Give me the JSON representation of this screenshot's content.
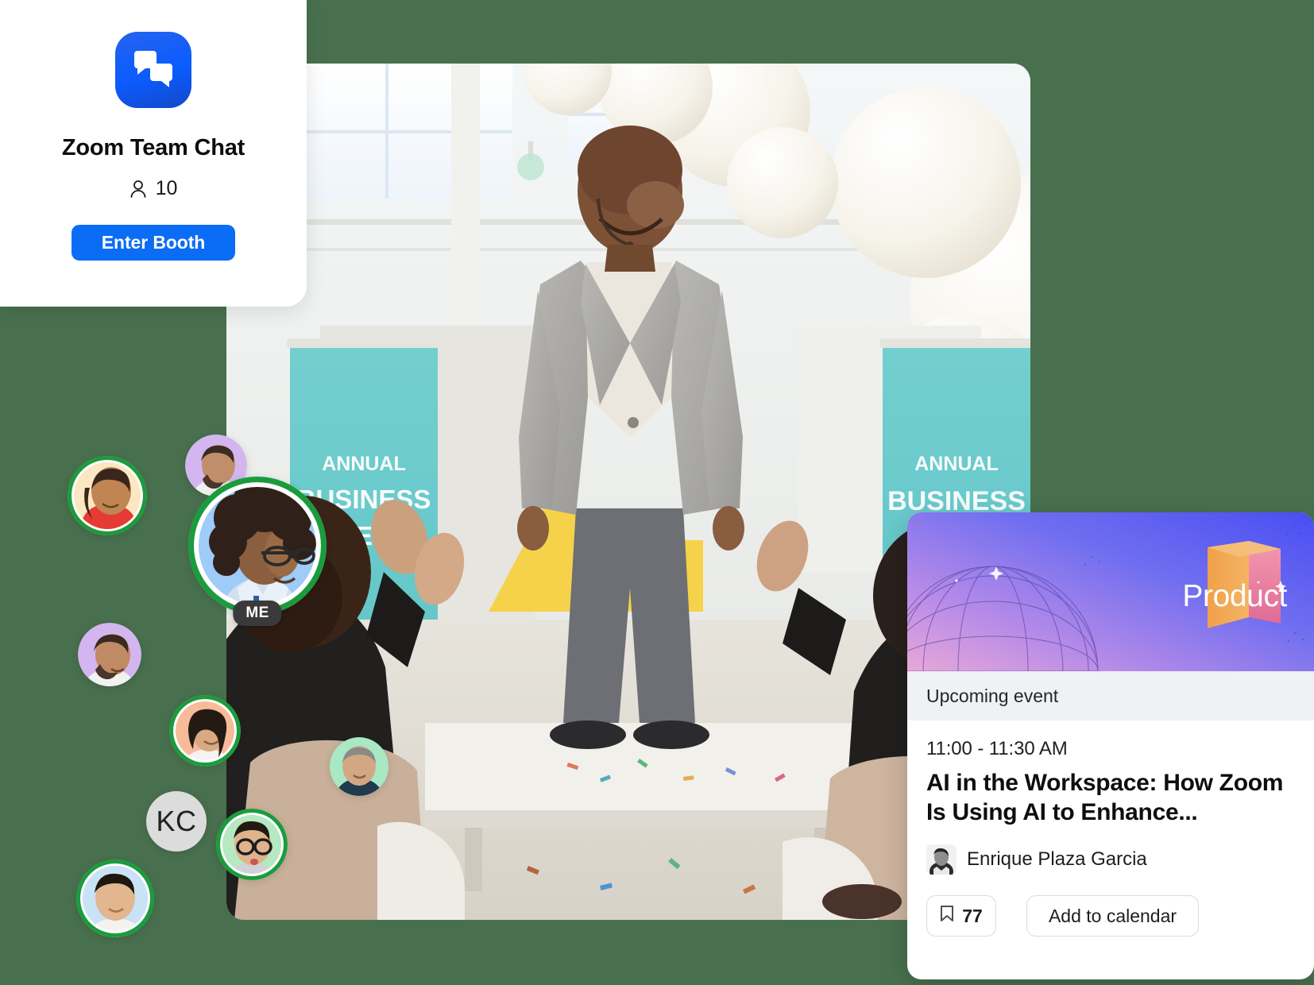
{
  "theme": {
    "page_background": "#48704e",
    "brand_blue": "#0b6cf5",
    "presence_green": "#1a9c3c",
    "card_white": "#ffffff"
  },
  "booth": {
    "logo_icon": "chat-bubbles-icon",
    "title": "Zoom Team Chat",
    "participants_icon": "person-icon",
    "participants_count": "10",
    "cta_label": "Enter Booth"
  },
  "stage_photo": {
    "alt": "speaker-on-stage-photo",
    "banner_texts": [
      "ANNUAL",
      "BUSINESS",
      "ANNUAL",
      "BUSINESS"
    ]
  },
  "participants": [
    {
      "name": "participant-1",
      "initials": "",
      "bg": "#fbe7c2",
      "active": true
    },
    {
      "name": "participant-2",
      "initials": "",
      "bg": "#d3b6f0",
      "active": false
    },
    {
      "name": "participant-me",
      "initials": "",
      "bg": "#9ecbf7",
      "active": true,
      "badge": "ME"
    },
    {
      "name": "participant-3",
      "initials": "",
      "bg": "#d3b6f0",
      "active": false
    },
    {
      "name": "participant-4",
      "initials": "",
      "bg": "#f7bb9a",
      "active": true
    },
    {
      "name": "participant-5",
      "initials": "",
      "bg": "#a8e8c4",
      "active": false
    },
    {
      "name": "participant-6",
      "initials": "KC",
      "bg": "#dcdcdc",
      "active": false
    },
    {
      "name": "participant-7",
      "initials": "",
      "bg": "#b6e8c2",
      "active": true
    },
    {
      "name": "participant-8",
      "initials": "",
      "bg": "#c9e2f5",
      "active": true
    }
  ],
  "event": {
    "category_label": "Product",
    "status_label": "Upcoming event",
    "time": "11:00 - 11:30 AM",
    "title": "AI in the Workspace: How Zoom Is Using AI to Enhance...",
    "speaker_name": "Enrique Plaza Garcia",
    "speaker_avatar_icon": "speaker-headshot",
    "save_icon": "bookmark-icon",
    "save_count": "77",
    "calendar_label": "Add to calendar"
  }
}
